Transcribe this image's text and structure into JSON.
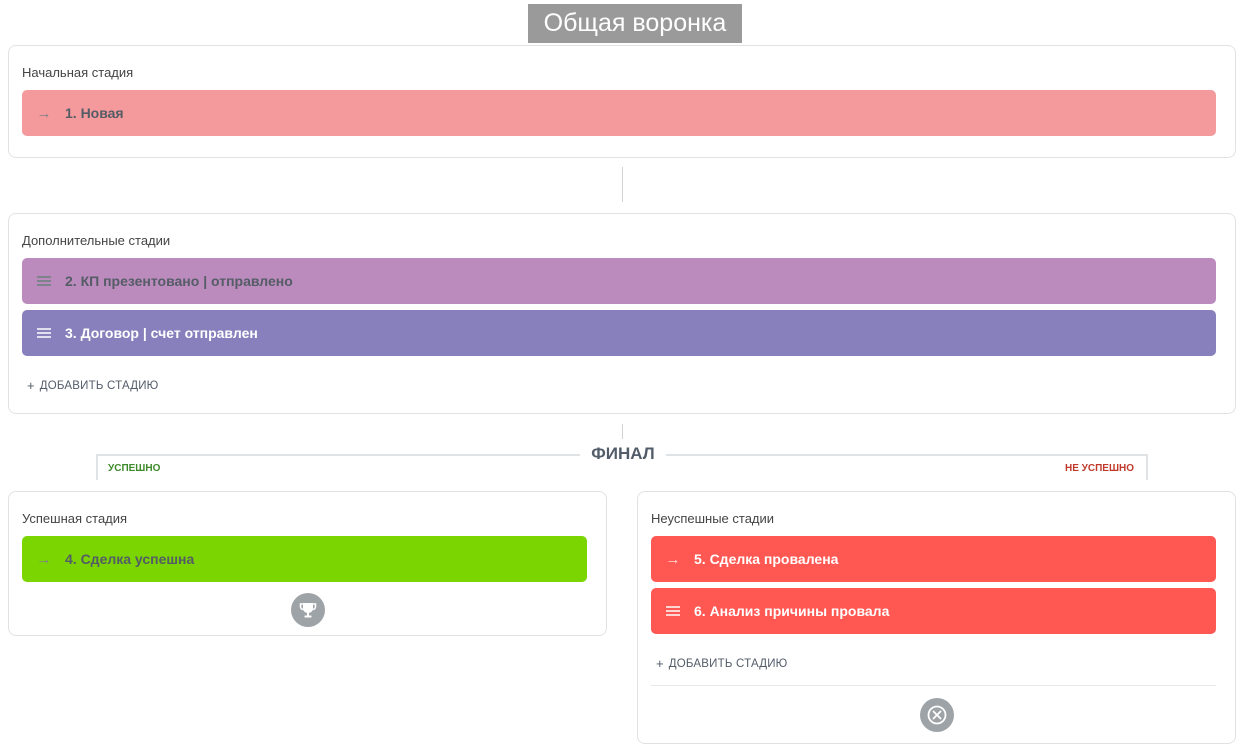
{
  "title": "Общая воронка",
  "initial": {
    "label": "Начальная стадия",
    "stages": [
      {
        "name": "1. Новая",
        "color": "#f59a9c",
        "icon": "arrow-right-icon"
      }
    ]
  },
  "additional": {
    "label": "Дополнительные стадии",
    "stages": [
      {
        "name": "2. КП презентовано | отправлено",
        "color": "#bc8bbd",
        "icon": "drag-handle-icon"
      },
      {
        "name": "3. Договор | счет отправлен",
        "color": "#8880bc",
        "icon": "drag-handle-icon"
      }
    ],
    "add_label": "ДОБАВИТЬ СТАДИЮ"
  },
  "final": {
    "label": "ФИНАЛ",
    "success_tag": "УСПЕШНО",
    "fail_tag": "НЕ УСПЕШНО",
    "success_tag_color": "#3d8a2a",
    "fail_tag_color": "#c0392b"
  },
  "success": {
    "label": "Успешная стадия",
    "stages": [
      {
        "name": "4. Сделка успешна",
        "color": "#7ad500",
        "icon": "arrow-right-icon"
      }
    ],
    "icon": "trophy-icon"
  },
  "fail": {
    "label": "Неуспешные стадии",
    "stages": [
      {
        "name": "5. Сделка провалена",
        "color": "#ff5752",
        "icon": "arrow-right-icon"
      },
      {
        "name": "6. Анализ причины провала",
        "color": "#ff5752",
        "icon": "drag-handle-icon"
      }
    ],
    "add_label": "ДОБАВИТЬ СТАДИЮ",
    "icon": "close-circle-icon"
  }
}
